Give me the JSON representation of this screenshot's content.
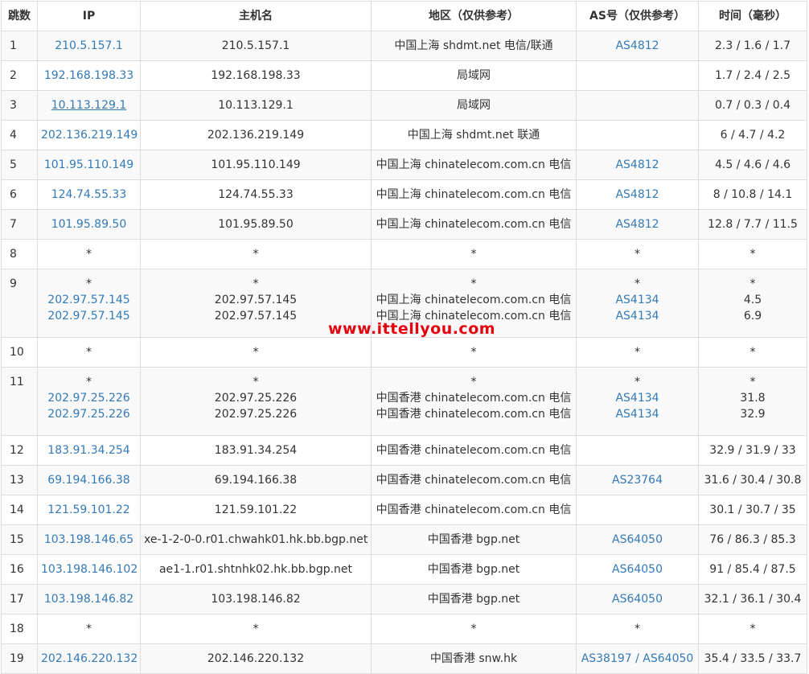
{
  "headers": {
    "hop": "跳数",
    "ip": "IP",
    "host": "主机名",
    "region": "地区（仅供参考）",
    "as": "AS号（仅供参考）",
    "time": "时间（毫秒）"
  },
  "rows": [
    {
      "hop": "1",
      "lines": [
        {
          "ip": "210.5.157.1",
          "host": "210.5.157.1",
          "region": "中国上海 shdmt.net 电信/联通",
          "as": "AS4812",
          "time": "2.3 / 1.6 / 1.7"
        }
      ]
    },
    {
      "hop": "2",
      "lines": [
        {
          "ip": "192.168.198.33",
          "host": "192.168.198.33",
          "region": "局域网",
          "as": "",
          "time": "1.7 / 2.4 / 2.5"
        }
      ]
    },
    {
      "hop": "3",
      "lines": [
        {
          "ip": "10.113.129.1",
          "host": "10.113.129.1",
          "region": "局域网",
          "as": "",
          "time": "0.7 / 0.3 / 0.4"
        }
      ]
    },
    {
      "hop": "4",
      "lines": [
        {
          "ip": "202.136.219.149",
          "host": "202.136.219.149",
          "region": "中国上海 shdmt.net 联通",
          "as": "",
          "time": "6 / 4.7 / 4.2"
        }
      ]
    },
    {
      "hop": "5",
      "lines": [
        {
          "ip": "101.95.110.149",
          "host": "101.95.110.149",
          "region": "中国上海 chinatelecom.com.cn 电信",
          "as": "AS4812",
          "time": "4.5 / 4.6 / 4.6"
        }
      ]
    },
    {
      "hop": "6",
      "lines": [
        {
          "ip": "124.74.55.33",
          "host": "124.74.55.33",
          "region": "中国上海 chinatelecom.com.cn 电信",
          "as": "AS4812",
          "time": "8 / 10.8 / 14.1"
        }
      ]
    },
    {
      "hop": "7",
      "lines": [
        {
          "ip": "101.95.89.50",
          "host": "101.95.89.50",
          "region": "中国上海 chinatelecom.com.cn 电信",
          "as": "AS4812",
          "time": "12.8 / 7.7 / 11.5"
        }
      ]
    },
    {
      "hop": "8",
      "lines": [
        {
          "ip": "*",
          "host": "*",
          "region": "*",
          "as": "*",
          "time": "*"
        }
      ]
    },
    {
      "hop": "9",
      "lines": [
        {
          "ip": "*",
          "host": "*",
          "region": "*",
          "as": "*",
          "time": "*"
        },
        {
          "ip": "202.97.57.145",
          "host": "202.97.57.145",
          "region": "中国上海 chinatelecom.com.cn 电信",
          "as": "AS4134",
          "time": "4.5"
        },
        {
          "ip": "202.97.57.145",
          "host": "202.97.57.145",
          "region": "中国上海 chinatelecom.com.cn 电信",
          "as": "AS4134",
          "time": "6.9"
        }
      ]
    },
    {
      "hop": "10",
      "lines": [
        {
          "ip": "*",
          "host": "*",
          "region": "*",
          "as": "*",
          "time": "*"
        }
      ]
    },
    {
      "hop": "11",
      "lines": [
        {
          "ip": "*",
          "host": "*",
          "region": "*",
          "as": "*",
          "time": "*"
        },
        {
          "ip": "202.97.25.226",
          "host": "202.97.25.226",
          "region": "中国香港 chinatelecom.com.cn 电信",
          "as": "AS4134",
          "time": "31.8"
        },
        {
          "ip": "202.97.25.226",
          "host": "202.97.25.226",
          "region": "中国香港 chinatelecom.com.cn 电信",
          "as": "AS4134",
          "time": "32.9"
        }
      ]
    },
    {
      "hop": "12",
      "lines": [
        {
          "ip": "183.91.34.254",
          "host": "183.91.34.254",
          "region": "中国香港 chinatelecom.com.cn 电信",
          "as": "",
          "time": "32.9 / 31.9 / 33"
        }
      ]
    },
    {
      "hop": "13",
      "lines": [
        {
          "ip": "69.194.166.38",
          "host": "69.194.166.38",
          "region": "中国香港 chinatelecom.com.cn 电信",
          "as": "AS23764",
          "time": "31.6 / 30.4 / 30.8"
        }
      ]
    },
    {
      "hop": "14",
      "lines": [
        {
          "ip": "121.59.101.22",
          "host": "121.59.101.22",
          "region": "中国香港 chinatelecom.com.cn 电信",
          "as": "",
          "time": "30.1 / 30.7 / 35"
        }
      ]
    },
    {
      "hop": "15",
      "lines": [
        {
          "ip": "103.198.146.65",
          "host": "xe-1-2-0-0.r01.chwahk01.hk.bb.bgp.net",
          "region": "中国香港 bgp.net",
          "as": "AS64050",
          "time": "76 / 86.3 / 85.3"
        }
      ]
    },
    {
      "hop": "16",
      "lines": [
        {
          "ip": "103.198.146.102",
          "host": "ae1-1.r01.shtnhk02.hk.bb.bgp.net",
          "region": "中国香港 bgp.net",
          "as": "AS64050",
          "time": "91 / 85.4 / 87.5"
        }
      ]
    },
    {
      "hop": "17",
      "lines": [
        {
          "ip": "103.198.146.82",
          "host": "103.198.146.82",
          "region": "中国香港 bgp.net",
          "as": "AS64050",
          "time": "32.1 / 36.1 / 30.4"
        }
      ]
    },
    {
      "hop": "18",
      "lines": [
        {
          "ip": "*",
          "host": "*",
          "region": "*",
          "as": "*",
          "time": "*"
        }
      ]
    },
    {
      "hop": "19",
      "lines": [
        {
          "ip": "202.146.220.132",
          "host": "202.146.220.132",
          "region": "中国香港 snw.hk",
          "as": "AS38197 / AS64050",
          "time": "35.4 / 33.5 / 33.7"
        }
      ]
    }
  ],
  "watermark": "www.ittellyou.com",
  "colors": {
    "link": "#337ab7",
    "watermark": "#e5000e",
    "border": "#dddddd",
    "stripe": "#f9f9f9"
  }
}
